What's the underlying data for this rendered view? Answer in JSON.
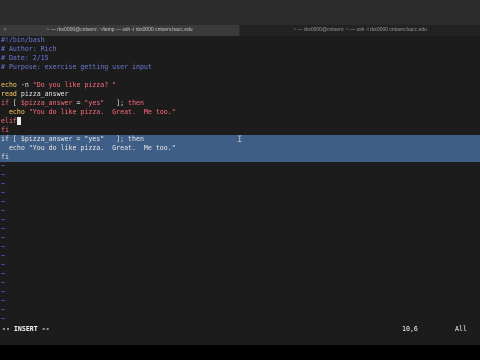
{
  "window": {
    "tabs": [
      {
        "title": "~ — rbx0000@cntserv: ~/temp — ssh -l rbx0000 cntserv.hacc.edu",
        "active": true
      },
      {
        "title": "~ — rbx0000@cntserv: ~ — ssh -l rbx0000 cntserv.hacc.edu",
        "active": false
      }
    ]
  },
  "editor": {
    "lines": [
      [
        {
          "t": "#!/bin/bash",
          "c": "c-com"
        }
      ],
      [
        {
          "t": "# Author: Rich",
          "c": "c-com"
        }
      ],
      [
        {
          "t": "# Date: 2/15",
          "c": "c-com"
        }
      ],
      [
        {
          "t": "# Purpose: exercise getting user input",
          "c": "c-com"
        }
      ],
      [],
      [
        {
          "t": "echo",
          "c": "c-sl"
        },
        {
          "t": " -n ",
          "c": "c-id"
        },
        {
          "t": "\"Do you like pizza? \"",
          "c": "c-str"
        }
      ],
      [
        {
          "t": "read",
          "c": "c-sl"
        },
        {
          "t": " pizza_answer",
          "c": "c-id"
        }
      ],
      [
        {
          "t": "if",
          "c": "c-cond"
        },
        {
          "t": " [ ",
          "c": "c-id"
        },
        {
          "t": "$pizza_answer",
          "c": "c-cond"
        },
        {
          "t": " = ",
          "c": "c-id"
        },
        {
          "t": "\"yes\"",
          "c": "c-str"
        },
        {
          "t": "   ]; ",
          "c": "c-id"
        },
        {
          "t": "then",
          "c": "c-cond"
        }
      ],
      [
        {
          "t": "  echo",
          "c": "c-sl"
        },
        {
          "t": " ",
          "c": "c-id"
        },
        {
          "t": "\"You do like pizza.  Great.  Me too.\"",
          "c": "c-str"
        }
      ],
      [
        {
          "t": "elif",
          "c": "c-cond"
        },
        {
          "t": " ",
          "c": "cursor"
        }
      ],
      [
        {
          "t": "fi",
          "c": "c-cond"
        }
      ],
      [
        {
          "t": "if [ $pizza_answer = \"yes\"   ]; then",
          "c": "c-id"
        }
      ],
      [
        {
          "t": "  echo \"You do like pizza.  Great.  Me too.\"",
          "c": "c-id"
        }
      ],
      [
        {
          "t": "fi",
          "c": "c-id"
        }
      ],
      [
        {
          "t": "~",
          "c": "c-tilde"
        }
      ],
      [
        {
          "t": "~",
          "c": "c-tilde"
        }
      ],
      [
        {
          "t": "~",
          "c": "c-tilde"
        }
      ],
      [
        {
          "t": "~",
          "c": "c-tilde"
        }
      ],
      [
        {
          "t": "~",
          "c": "c-tilde"
        }
      ],
      [
        {
          "t": "~",
          "c": "c-tilde"
        }
      ],
      [
        {
          "t": "~",
          "c": "c-tilde"
        }
      ],
      [
        {
          "t": "~",
          "c": "c-tilde"
        }
      ],
      [
        {
          "t": "~",
          "c": "c-tilde"
        }
      ],
      [
        {
          "t": "~",
          "c": "c-tilde"
        }
      ],
      [
        {
          "t": "~",
          "c": "c-tilde"
        }
      ],
      [
        {
          "t": "~",
          "c": "c-tilde"
        }
      ],
      [
        {
          "t": "~",
          "c": "c-tilde"
        }
      ],
      [
        {
          "t": "~",
          "c": "c-tilde"
        }
      ],
      [
        {
          "t": "~",
          "c": "c-tilde"
        }
      ],
      [
        {
          "t": "~",
          "c": "c-tilde"
        }
      ],
      [
        {
          "t": "~",
          "c": "c-tilde"
        }
      ],
      [
        {
          "t": "~",
          "c": "c-tilde"
        }
      ]
    ],
    "selected_lines": [
      11,
      12,
      13
    ]
  },
  "statusbar": {
    "mode": "-- INSERT --",
    "position": "10,6",
    "scroll": "All"
  }
}
